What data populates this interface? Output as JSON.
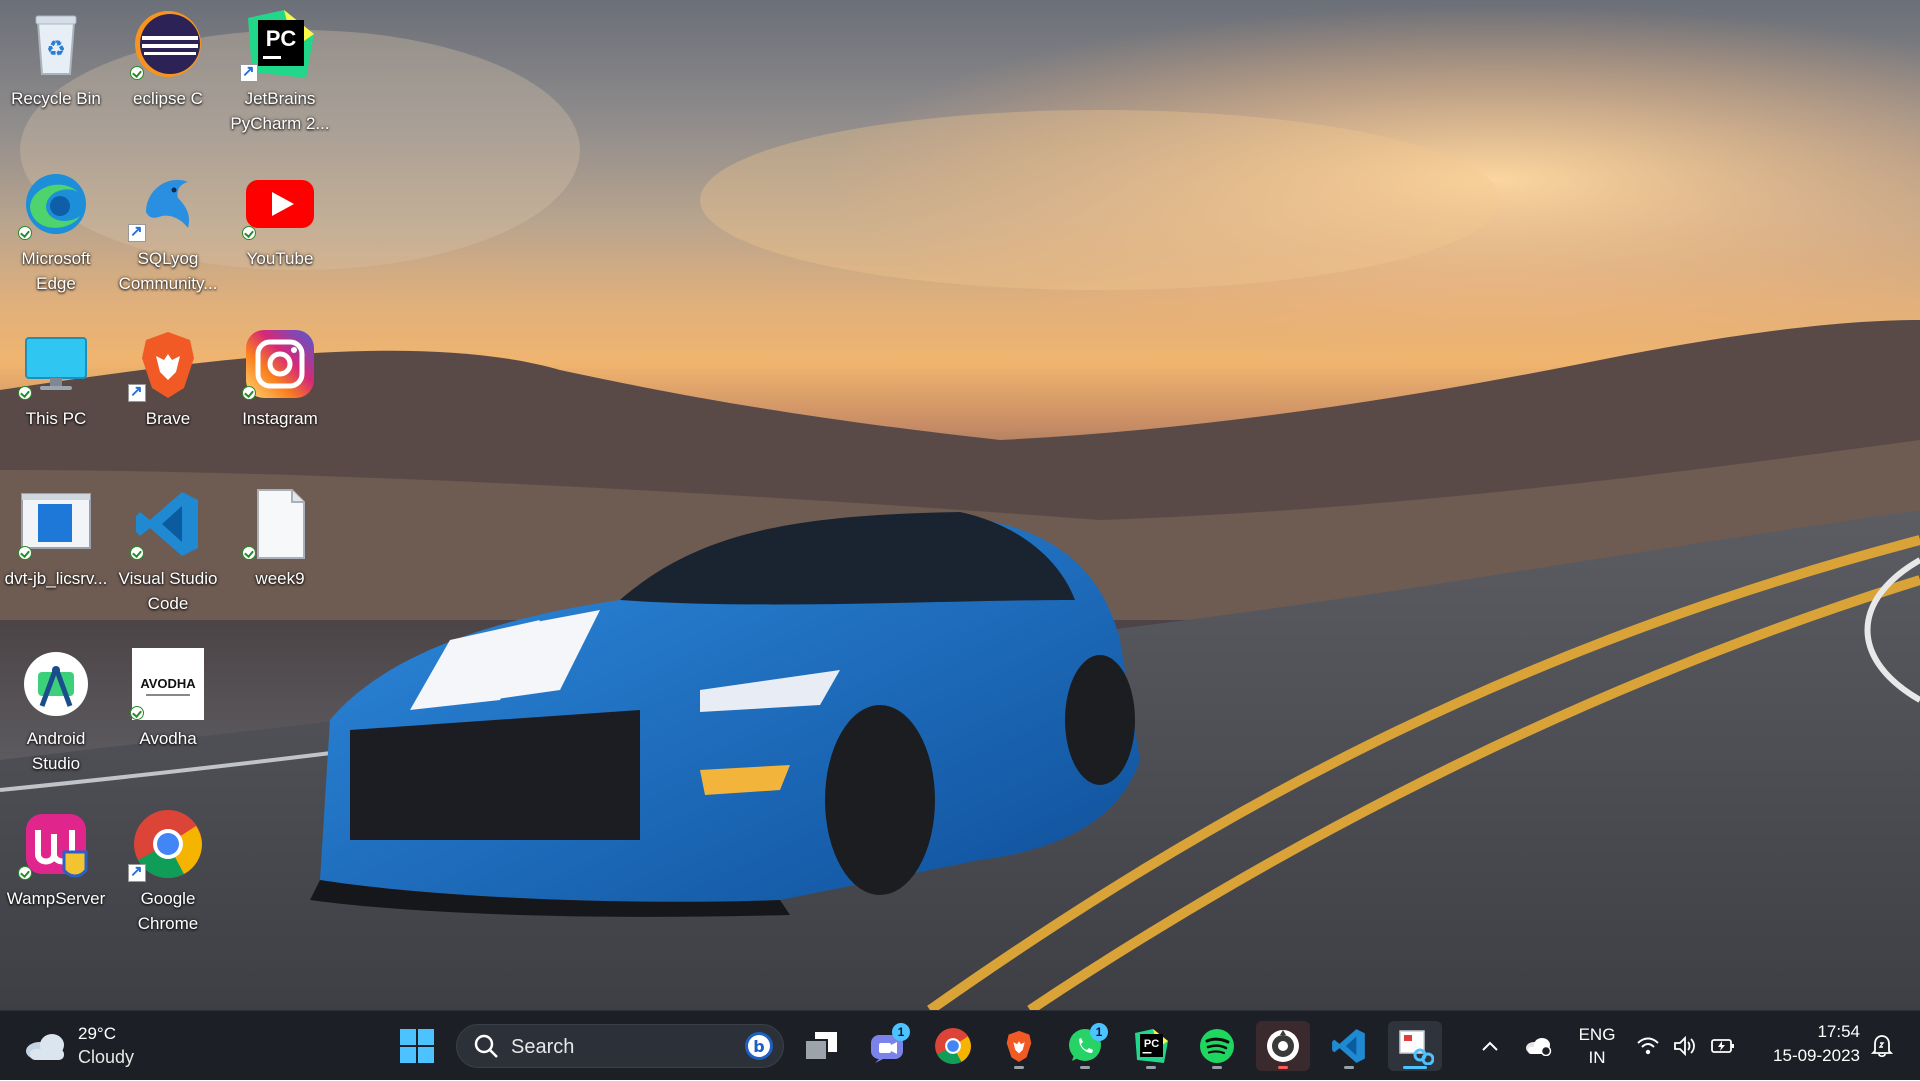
{
  "desktop": {
    "icons": [
      {
        "label": "Recycle Bin"
      },
      {
        "label": "eclipse C"
      },
      {
        "label": "JetBrains PyCharm 2..."
      },
      {
        "label": "Microsoft Edge"
      },
      {
        "label": "SQLyog Community..."
      },
      {
        "label": "YouTube"
      },
      {
        "label": "This PC"
      },
      {
        "label": "Brave"
      },
      {
        "label": "Instagram"
      },
      {
        "label": "dvt-jb_licsrv..."
      },
      {
        "label": "Visual Studio Code"
      },
      {
        "label": "week9"
      },
      {
        "label": "Android Studio"
      },
      {
        "label": "Avodha"
      },
      {
        "label": "WampServer"
      },
      {
        "label": "Google Chrome"
      }
    ],
    "icon_text": {
      "pycharm": "PC",
      "avodha": "AVODHA"
    }
  },
  "taskbar": {
    "weather": {
      "temp": "29°C",
      "condition": "Cloudy"
    },
    "search": {
      "label": "Search"
    },
    "apps": [
      {
        "name": "Task View"
      },
      {
        "name": "Teams Chat",
        "badge": "1"
      },
      {
        "name": "Google Chrome"
      },
      {
        "name": "Brave"
      },
      {
        "name": "WhatsApp",
        "badge": "1"
      },
      {
        "name": "PyCharm"
      },
      {
        "name": "Spotify"
      },
      {
        "name": "Recorder"
      },
      {
        "name": "Visual Studio Code"
      },
      {
        "name": "Snipping Tool"
      }
    ],
    "tray": {
      "lang": "ENG",
      "region": "IN",
      "time": "17:54",
      "date": "15-09-2023"
    }
  },
  "colors": {
    "taskbar_bg": "#1c1f26",
    "accent": "#4cc2ff"
  }
}
